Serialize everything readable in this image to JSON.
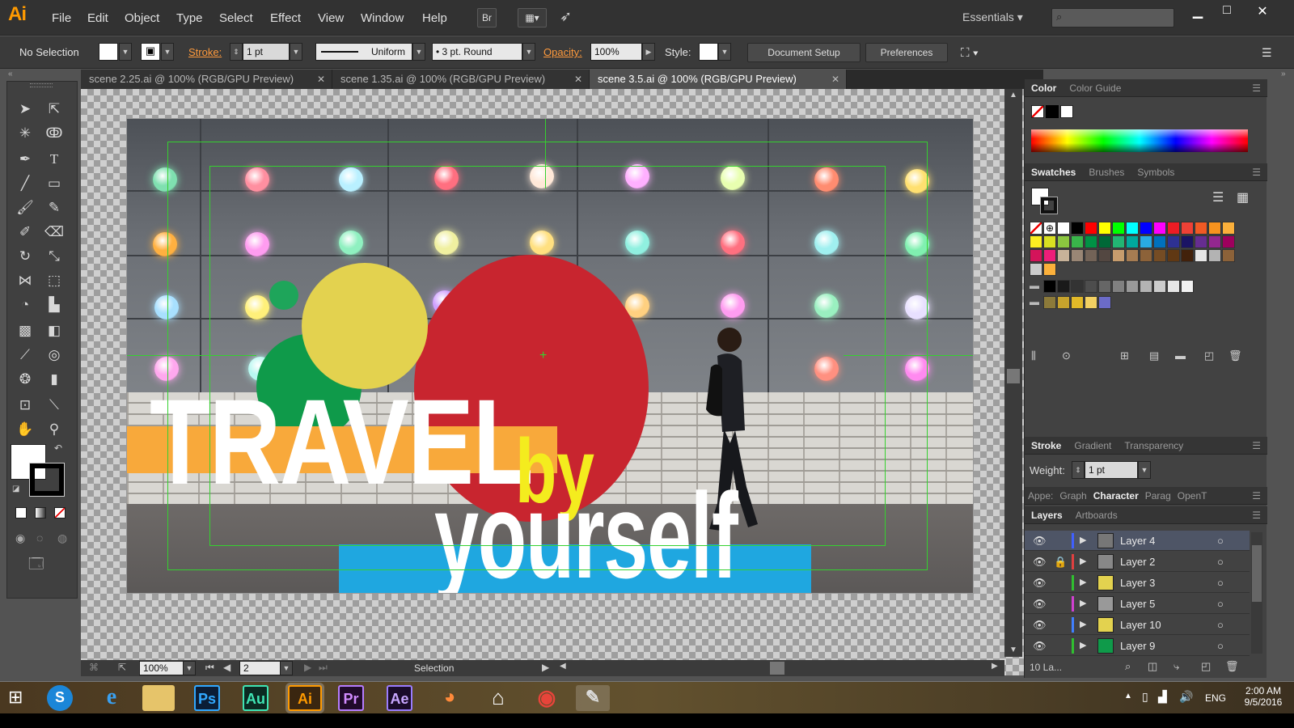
{
  "app": {
    "logo": "Ai"
  },
  "menu": [
    "File",
    "Edit",
    "Object",
    "Type",
    "Select",
    "Effect",
    "View",
    "Window",
    "Help"
  ],
  "bridge_button": "Br",
  "workspace": "Essentials",
  "control": {
    "selection_label": "No Selection",
    "stroke_label": "Stroke:",
    "stroke_value": "1 pt",
    "profile": "Uniform",
    "brush": "3 pt. Round",
    "opacity_label": "Opacity:",
    "opacity_value": "100%",
    "style_label": "Style:",
    "document_setup": "Document Setup",
    "preferences": "Preferences"
  },
  "tabs": [
    {
      "label": "scene 2.25.ai @ 100% (RGB/GPU Preview)"
    },
    {
      "label": "scene 1.35.ai @ 100% (RGB/GPU Preview)"
    },
    {
      "label": "scene 3.5.ai @ 100% (RGB/GPU Preview)"
    }
  ],
  "artwork": {
    "word1": "TRAVEL",
    "word2": "by",
    "word3": "yourself"
  },
  "colors": {
    "red": "#c8252f",
    "yellow": "#e3d24f",
    "green": "#0f9a4a",
    "orange": "#f8a93b",
    "blue": "#1fa7e0",
    "accent": "#ff9a00"
  },
  "status": {
    "zoom": "100%",
    "artboard": "2",
    "tool": "Selection"
  },
  "panels": {
    "color_tabs": [
      "Color",
      "Color Guide"
    ],
    "swatch_tabs": [
      "Swatches",
      "Brushes",
      "Symbols"
    ],
    "stroke_tabs": [
      "Stroke",
      "Gradient",
      "Transparency"
    ],
    "weight_label": "Weight:",
    "weight_value": "1 pt",
    "char_tabs": [
      "Appe:",
      "Graph",
      "Character",
      "Parag",
      "OpenT"
    ],
    "layers_tabs": [
      "Layers",
      "Artboards"
    ],
    "layers": [
      {
        "name": "Layer 4"
      },
      {
        "name": "Layer 2"
      },
      {
        "name": "Layer 3"
      },
      {
        "name": "Layer 5"
      },
      {
        "name": "Layer 10"
      },
      {
        "name": "Layer 9"
      }
    ],
    "layers_count": "10 La..."
  },
  "taskbar": {
    "ps": "Ps",
    "au": "Au",
    "ai": "Ai",
    "pr": "Pr",
    "ae": "Ae",
    "lang": "ENG",
    "time": "2:00 AM",
    "date": "9/5/2016"
  }
}
